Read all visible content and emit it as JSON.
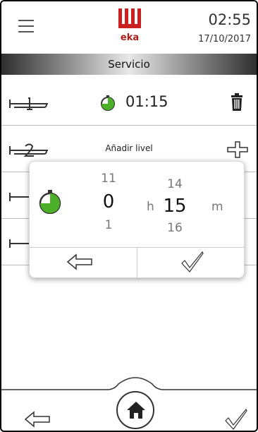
{
  "header": {
    "menu_icon": "hamburger-menu-icon",
    "brand": "eka",
    "brand_color": "#cc1f1f",
    "time": "02:55",
    "date": "17/10/2017"
  },
  "title": "Servicio",
  "rows": [
    {
      "time": "01:15",
      "timer_color": "#4caf2a",
      "action_icon": "trash-icon"
    },
    {
      "label": "Añadir livel",
      "action_icon": "plus-icon"
    }
  ],
  "dialog": {
    "hours": {
      "prev": "11",
      "current": "0",
      "next": "1",
      "unit": "h"
    },
    "minutes": {
      "prev": "14",
      "current": "15",
      "next": "16",
      "unit": "m"
    },
    "timer_color": "#4caf2a",
    "back_icon": "back-arrow-icon",
    "confirm_icon": "checkmark-icon"
  },
  "footer": {
    "back_icon": "back-arrow-icon",
    "home_icon": "home-icon",
    "confirm_icon": "checkmark-icon"
  }
}
